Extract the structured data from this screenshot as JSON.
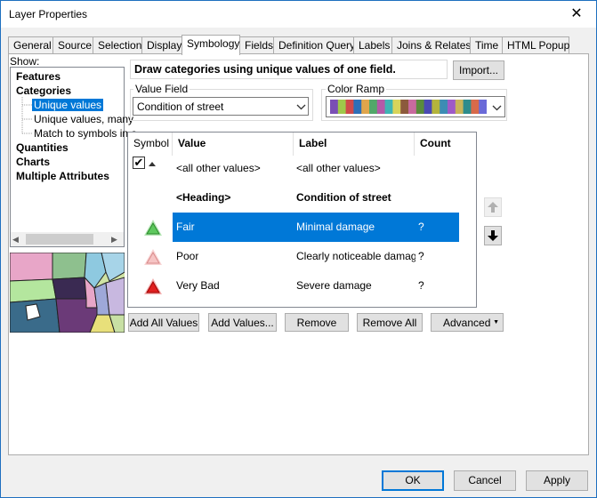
{
  "window": {
    "title": "Layer Properties",
    "close_glyph": "✕"
  },
  "tabs": [
    "General",
    "Source",
    "Selection",
    "Display",
    "Symbology",
    "Fields",
    "Definition Query",
    "Labels",
    "Joins & Relates",
    "Time",
    "HTML Popup"
  ],
  "active_tab": "Symbology",
  "show": {
    "label": "Show:",
    "tree": {
      "features": "Features",
      "categories": "Categories",
      "unique_values": "Unique values",
      "unique_values_many": "Unique values, many",
      "match_symbols": "Match to symbols in a",
      "quantities": "Quantities",
      "charts": "Charts",
      "multiple_attributes": "Multiple Attributes"
    }
  },
  "description": "Draw categories using unique values of one field.",
  "import_button": "Import...",
  "value_field": {
    "label": "Value Field",
    "value": "Condition of street"
  },
  "color_ramp": {
    "label": "Color Ramp",
    "colors": [
      "#7a4fb5",
      "#9fc84a",
      "#d04a4a",
      "#2d6fb8",
      "#e0a54c",
      "#52a86a",
      "#b45aa8",
      "#3fb4b4",
      "#d8d45a",
      "#8c5a3c",
      "#c86a9e",
      "#5a8c3c",
      "#4a4ab4",
      "#b4b43c",
      "#3c8cb4",
      "#9e5ac8",
      "#c8b45a",
      "#2d8c8c",
      "#d86a4a",
      "#6a6ad8"
    ]
  },
  "table": {
    "headers": {
      "symbol": "Symbol",
      "value": "Value",
      "label": "Label",
      "count": "Count"
    },
    "rows": [
      {
        "value": "<all other values>",
        "label": "<all other values>",
        "count": "",
        "symbol": "small-arrow-icon",
        "checked": true
      },
      {
        "value": "<Heading>",
        "label": "Condition of street",
        "count": "",
        "symbol": "",
        "heading": true
      },
      {
        "value": "Fair",
        "label": "Minimal damage",
        "count": "?",
        "symbol": "triangle-green-icon",
        "color": "#5ec85e",
        "selected": true
      },
      {
        "value": "Poor",
        "label": "Clearly noticeable damage, r",
        "count": "?",
        "symbol": "triangle-pink-icon",
        "color": "#f0a0a0"
      },
      {
        "value": "Very Bad",
        "label": "Severe damage",
        "count": "?",
        "symbol": "triangle-red-icon",
        "color": "#e02020"
      }
    ]
  },
  "buttons": {
    "add_all_values": "Add All Values",
    "add_values": "Add Values...",
    "remove": "Remove",
    "remove_all": "Remove All",
    "advanced": "Advanced",
    "ok": "OK",
    "cancel": "Cancel",
    "apply": "Apply"
  }
}
